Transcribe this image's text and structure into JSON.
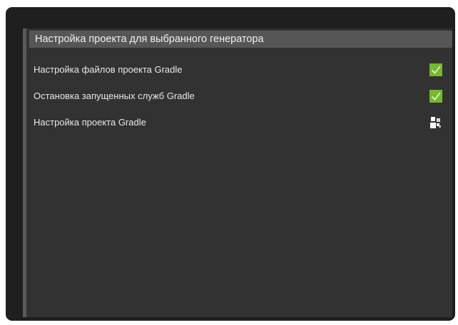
{
  "panel": {
    "header": "Настройка проекта для выбранного генератора",
    "steps": [
      {
        "label": "Настройка файлов проекта Gradle",
        "status_icon": "checkmark-icon",
        "status": "done"
      },
      {
        "label": "Остановка запущенных служб Gradle",
        "status_icon": "checkmark-icon",
        "status": "done"
      },
      {
        "label": "Настройка проекта Gradle",
        "status_icon": "progress-spinner-icon",
        "status": "in-progress"
      }
    ]
  },
  "colors": {
    "outer_background": "#1f1f1f",
    "panel_background": "#323232",
    "header_background": "#565656",
    "check_green": "#77b82c"
  }
}
